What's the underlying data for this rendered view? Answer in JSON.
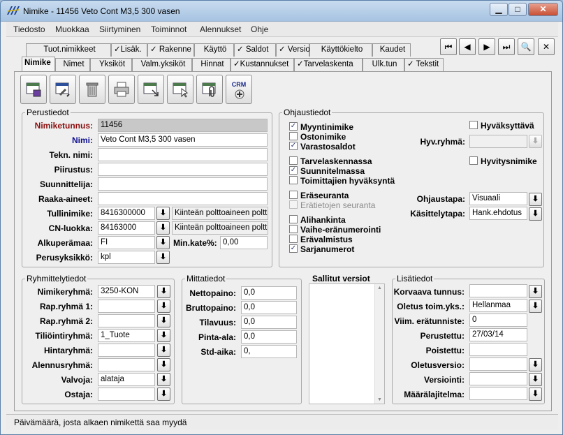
{
  "window": {
    "title": "Nimike - 11456 Veto Cont M3,5 300 vasen",
    "minimize": "▁",
    "maximize": "□",
    "close": "✕"
  },
  "menu": [
    "Tiedosto",
    "Muokkaa",
    "Siirtyminen",
    "Toiminnot",
    "Alennukset",
    "Ohje"
  ],
  "tabs_row1": [
    "Tuot.nimikkeet",
    "✓Lisäk.",
    "✓ Rakenne",
    "Käyttö",
    "✓ Saldot",
    "✓ Versiot",
    "Käyttökielto",
    "Kaudet"
  ],
  "tabs_row2": [
    "Nimike",
    "Nimet",
    "Yksiköt",
    "Valm.yksiköt",
    "Hinnat",
    "✓Kustannukset",
    "✓Tarvelaskenta",
    "Ulk.tun",
    "✓ Tekstit"
  ],
  "nav_buttons": [
    "⏮",
    "◀",
    "▶",
    "⏭",
    "🔍",
    "✕"
  ],
  "crm_label": "CRM",
  "perustiedot": {
    "title": "Perustiedot",
    "labels": [
      "Nimiketunnus:",
      "Nimi:",
      "Tekn. nimi:",
      "Piirustus:",
      "Suunnittelija:",
      "Raaka-aineet:",
      "Tullinimike:",
      "CN-luokka:",
      "Alkuperämaa:",
      "Perusyksikkö:"
    ],
    "nimiketunnus": "11456",
    "nimi": "Veto Cont M3,5 300 vasen",
    "tullinimike": "8416300000",
    "tullinimike_desc": "Kiinteän polttoaineen polttim",
    "cn_luokka": "84163000",
    "cn_desc": "Kiinteän polttoaineen polttim",
    "alkuperamaa": "FI",
    "min_kate_label": "Min.kate%:",
    "min_kate": "0,00",
    "perusyksikko": "kpl"
  },
  "ohjaustiedot": {
    "title": "Ohjaustiedot",
    "checks": [
      {
        "label": "Myyntinimike",
        "checked": "✓"
      },
      {
        "label": "Ostonimike",
        "checked": ""
      },
      {
        "label": "Varastosaldot",
        "checked": "✓"
      },
      {
        "label": "Tarvelaskennassa",
        "checked": ""
      },
      {
        "label": "Suunnitelmassa",
        "checked": "✓"
      },
      {
        "label": "Toimittajien hyväksyntä",
        "checked": ""
      },
      {
        "label": "Eräseuranta",
        "checked": ""
      },
      {
        "label": "Erätietojen seuranta",
        "checked": ""
      },
      {
        "label": "Alihankinta",
        "checked": ""
      },
      {
        "label": "Vaihe-eränumerointi",
        "checked": ""
      },
      {
        "label": "Erävalmistus",
        "checked": ""
      },
      {
        "label": "Sarjanumerot",
        "checked": "✓"
      }
    ],
    "hyvaksyttava": "Hyväksyttävä",
    "hyv_ryhma_label": "Hyv.ryhmä:",
    "hyvitysnimike": "Hyvitysnimike",
    "ohjaustapa_label": "Ohjaustapa:",
    "ohjaustapa": "Visuaali",
    "kasittelytapa_label": "Käsittelytapa:",
    "kasittelytapa": "Hank.ehdotus"
  },
  "ryhmittely": {
    "title": "Ryhmittelytiedot",
    "labels": [
      "Nimikeryhmä:",
      "Rap.ryhmä 1:",
      "Rap.ryhmä 2:",
      "Tiliöintiryhmä:",
      "Hintaryhmä:",
      "Alennusryhmä:",
      "Valvoja:",
      "Ostaja:"
    ],
    "values": [
      "3250-KON",
      "",
      "",
      "1_Tuote",
      "",
      "",
      "alataja",
      ""
    ]
  },
  "mitta": {
    "title": "Mittatiedot",
    "labels": [
      "Nettopaino:",
      "Bruttopaino:",
      "Tilavuus:",
      "Pinta-ala:",
      "Std-aika:"
    ],
    "values": [
      "0,0",
      "0,0",
      "0,0",
      "0,0",
      "0,"
    ]
  },
  "versiot": {
    "title": "Sallitut versiot"
  },
  "lisatiedot": {
    "title": "Lisätiedot",
    "labels": [
      "Korvaava tunnus:",
      "Oletus toim.yks.:",
      "Viim. erätunniste:",
      "Perustettu:",
      "Poistettu:",
      "Oletusversio:",
      "Versiointi:",
      "Määrälajitelma:"
    ],
    "values": [
      "",
      "Hellanmaa",
      "0",
      "27/03/14",
      "",
      "",
      "",
      ""
    ]
  },
  "status": "Päivämäärä, josta alkaen nimikettä saa myydä"
}
